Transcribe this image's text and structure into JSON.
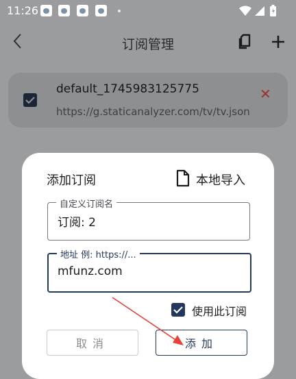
{
  "status_bar": {
    "time": "11:26",
    "notification_icons": [
      "baidu-icon",
      "baidu-icon",
      "baidu-icon",
      "baidu-icon"
    ],
    "system_icons": [
      "wifi-icon",
      "signal-icon",
      "battery-icon"
    ]
  },
  "appbar": {
    "title": "订阅管理",
    "back_icon": "chevron-left-icon",
    "actions": [
      "copy-icon",
      "plus-icon"
    ]
  },
  "subscription": {
    "checked": true,
    "name": "default_1745983125775",
    "url": "https://g.staticanalyzer.com/tv/tv.json",
    "delete_symbol": "✕"
  },
  "dialog": {
    "title": "添加订阅",
    "import_label": "本地导入",
    "name_field": {
      "label": "自定义订阅名",
      "value": "订阅: 2"
    },
    "url_field": {
      "label": "地址 例: https://...",
      "value": "mfunz.com"
    },
    "use_checkbox": {
      "checked": true,
      "label": "使用此订阅"
    },
    "cancel_label": "取消",
    "confirm_label": "添加"
  },
  "colors": {
    "scrim": "#9a9c9e",
    "card": "#8d8f91",
    "accent": "#24385e",
    "danger": "#9a2f2f",
    "annotation_arrow": "#e8413b"
  }
}
